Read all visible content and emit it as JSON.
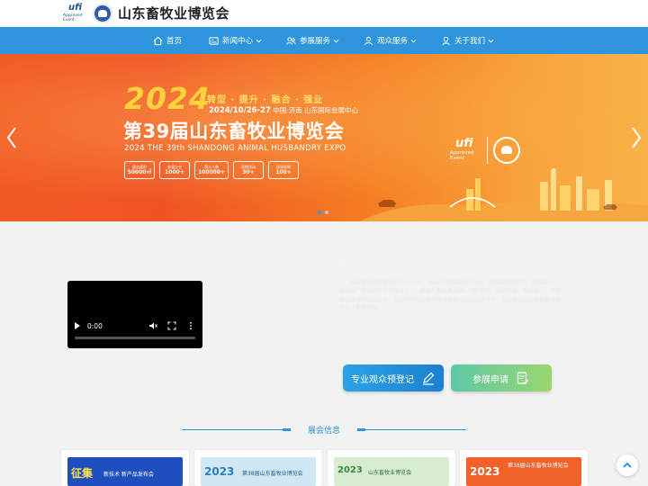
{
  "header": {
    "ufi_word": "ufi",
    "ufi_sub": "Approved Event",
    "site_title": "山东畜牧业博览会"
  },
  "nav": {
    "items": [
      {
        "label": "首页",
        "icon": "home-icon",
        "has_dropdown": false
      },
      {
        "label": "新闻中心",
        "icon": "news-icon",
        "has_dropdown": true
      },
      {
        "label": "参展服务",
        "icon": "users-icon",
        "has_dropdown": true
      },
      {
        "label": "观众服务",
        "icon": "person-icon",
        "has_dropdown": true
      },
      {
        "label": "关于我们",
        "icon": "contact-icon",
        "has_dropdown": true
      }
    ]
  },
  "banner": {
    "year": "2024",
    "slogan": "转型 · 提升 · 融合 · 强业",
    "date": "2024/10/26-27",
    "location": "中国·济南  山东国际会展中心",
    "main_title": "第39届山东畜牧业博览会",
    "sub_title": "2024 THE 39th SHANDONG ANIMAL HUSBANDRY EXPO",
    "stats": [
      {
        "label": "展览面积",
        "value": "50000㎡"
      },
      {
        "label": "参展企业",
        "value": "1000+"
      },
      {
        "label": "观众人数",
        "value": "100000+"
      },
      {
        "label": "同期活动",
        "value": "30+"
      },
      {
        "label": "现场采购",
        "value": "100+"
      }
    ],
    "badge_ufi_word": "ufi",
    "badge_ufi_sub": "Approved Event",
    "slide_count": 2,
    "active_slide": 0
  },
  "intro": {
    "heading": "山东畜牧业介绍",
    "video_time": "0:00",
    "text": "山东畜牧业博览会始于1983年，由山东省畜牧协会主办，是国内创办最早、规模最大、影响最广的畜牧业专业展会之一。展会汇聚畜禽养殖、饲料兽药、畜牧机械、屠宰加工、环保设备等全产业链企业，搭建了行业交流合作与贸易洽谈的重要平台，为推动畜牧业高质量发展作出了积极贡献。",
    "btn_register": "专业观众预登记",
    "btn_exhibit": "参展申请"
  },
  "news": {
    "title": "展会信息",
    "cards": [
      {
        "headline": "征集",
        "sub": "新技术 新产品发布会"
      },
      {
        "headline": "2023",
        "sub": "第38届山东畜牧业博览会"
      },
      {
        "headline": "2023",
        "sub": "山东畜牧业博览会"
      },
      {
        "headline": "2023",
        "sub": "第38届山东畜牧业博览会"
      }
    ]
  },
  "colors": {
    "nav_blue": "#2e94dc",
    "banner_orange": "#f25a24",
    "banner_yellow": "#ffd23c",
    "btn_register": "#1d7fd1",
    "btn_exhibit": "#5fc8a8"
  }
}
